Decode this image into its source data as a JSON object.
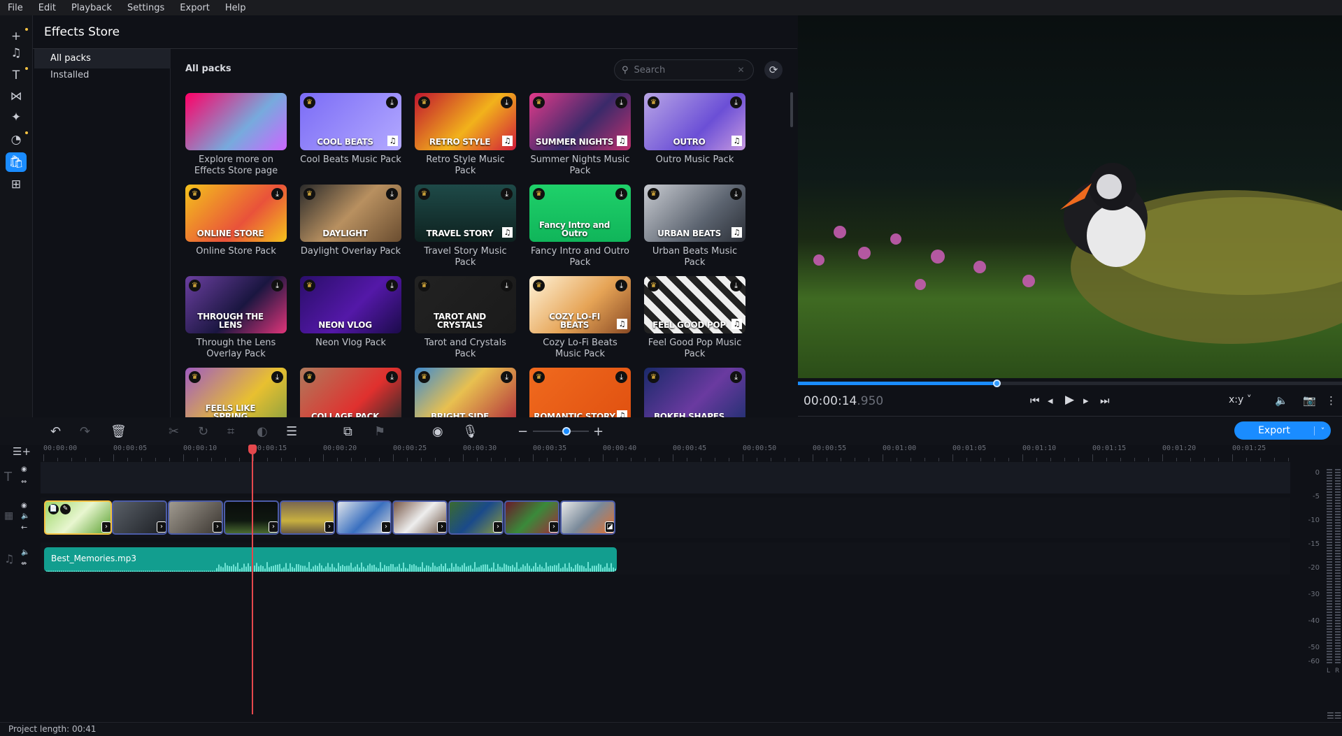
{
  "menu": [
    "File",
    "Edit",
    "Playback",
    "Settings",
    "Export",
    "Help"
  ],
  "sidebar_icons": [
    {
      "name": "add-icon",
      "glyph": "+",
      "dot": true
    },
    {
      "name": "music-icon",
      "glyph": "♫",
      "dot": false
    },
    {
      "name": "text-icon",
      "glyph": "T",
      "dot": true
    },
    {
      "name": "transitions-icon",
      "glyph": "⋈",
      "dot": false
    },
    {
      "name": "effects-icon",
      "glyph": "✦",
      "dot": false
    },
    {
      "name": "stickers-icon",
      "glyph": "◔",
      "dot": true
    },
    {
      "name": "store-icon",
      "glyph": "🛍",
      "dot": false,
      "active": true
    },
    {
      "name": "more-tools-icon",
      "glyph": "⊞",
      "dot": false
    }
  ],
  "store": {
    "title": "Effects Store",
    "nav": [
      {
        "label": "All packs",
        "active": true
      },
      {
        "label": "Installed",
        "active": false
      }
    ],
    "grid_title": "All packs",
    "search_placeholder": "Search",
    "packs": [
      {
        "label": "Explore more on Effects Store page",
        "overlay": "",
        "bg": "linear-gradient(135deg,#f06,#7ad 60%,#c6f)",
        "premium": false,
        "music": false
      },
      {
        "label": "Cool Beats Music Pack",
        "overlay": "COOL BEATS",
        "bg": "linear-gradient(135deg,#7b6cf6,#b3a9ff)",
        "premium": true,
        "music": true
      },
      {
        "label": "Retro Style Music Pack",
        "overlay": "RETRO STYLE",
        "bg": "linear-gradient(135deg,#c0152f,#f2b21b 55%,#d01b3a)",
        "premium": true,
        "music": true
      },
      {
        "label": "Summer Nights Music Pack",
        "overlay": "SUMMER NIGHTS",
        "bg": "linear-gradient(135deg,#e23a8a,#3a2a6a 55%,#c0306e)",
        "premium": true,
        "music": true
      },
      {
        "label": "Outro Music Pack",
        "overlay": "OUTRO",
        "bg": "linear-gradient(135deg,#b9a6e6,#6b4fd6 60%,#c79ae0)",
        "premium": true,
        "music": true
      },
      {
        "label": "Online Store Pack",
        "overlay": "ONLINE STORE",
        "bg": "linear-gradient(135deg,#f4c21c,#e9523a 60%,#f4c21c)",
        "premium": true,
        "music": false
      },
      {
        "label": "Daylight Overlay Pack",
        "overlay": "DAYLIGHT",
        "bg": "linear-gradient(135deg,#2a2a2a,#b89060 50%,#6a4d30)",
        "premium": true,
        "music": false
      },
      {
        "label": "Travel Story Music Pack",
        "overlay": "TRAVEL STORY",
        "bg": "linear-gradient(180deg,#1e4a48,#0e2220)",
        "premium": true,
        "music": true
      },
      {
        "label": "Fancy Intro and Outro Pack",
        "overlay": "Fancy Intro and Outro",
        "bg": "linear-gradient(180deg,#1fd16a,#10b55a)",
        "premium": true,
        "music": false
      },
      {
        "label": "Urban Beats Music Pack",
        "overlay": "URBAN BEATS",
        "bg": "linear-gradient(135deg,#c9ccd2,#5c6470 60%,#2a2e36)",
        "premium": true,
        "music": true
      },
      {
        "label": "Through the Lens Overlay Pack",
        "overlay": "THROUGH THE LENS",
        "bg": "linear-gradient(135deg,#6b3fa0,#1a1640 55%,#e0357a)",
        "premium": true,
        "music": false
      },
      {
        "label": "Neon Vlog Pack",
        "overlay": "NEON VLOG",
        "bg": "linear-gradient(135deg,#2a0e6a,#5418a8 55%,#1b0b4a)",
        "premium": true,
        "music": false
      },
      {
        "label": "Tarot and Crystals Pack",
        "overlay": "TAROT AND CRYSTALS",
        "bg": "linear-gradient(135deg,#222,#1a1a1a)",
        "premium": true,
        "music": false
      },
      {
        "label": "Cozy Lo-Fi Beats Music Pack",
        "overlay": "COZY LO-FI BEATS",
        "bg": "linear-gradient(135deg,#fff3d8,#e6a456 55%,#8a4a24)",
        "premium": true,
        "music": true
      },
      {
        "label": "Feel Good Pop Music Pack",
        "overlay": "FEEL GOOD POP",
        "bg": "repeating-linear-gradient(45deg,#222 0 10px,#eee 10px 20px)",
        "premium": true,
        "music": true
      },
      {
        "label": "",
        "overlay": "FEELS LIKE SPRING",
        "bg": "linear-gradient(135deg,#a05cc0,#e8c030 60%,#8aa040)",
        "premium": true,
        "music": false
      },
      {
        "label": "",
        "overlay": "COLLAGE PACK",
        "bg": "linear-gradient(135deg,#b07a5c,#e0302e 60%,#2a2a2a)",
        "premium": true,
        "music": false
      },
      {
        "label": "",
        "overlay": "BRIGHT SIDE",
        "bg": "linear-gradient(135deg,#3c8ad0,#e8c050 45%,#b02a3a)",
        "premium": true,
        "music": false
      },
      {
        "label": "",
        "overlay": "ROMANTIC STORY",
        "bg": "linear-gradient(135deg,#f06a1e,#e05010)",
        "premium": true,
        "music": true
      },
      {
        "label": "",
        "overlay": "BOKEH SHAPES",
        "bg": "linear-gradient(135deg,#1a2a6a,#6a3aa0 55%,#203070)",
        "premium": true,
        "music": false
      }
    ]
  },
  "player": {
    "timecode_main": "00:00:14",
    "timecode_ms": ".950",
    "progress_percent": 36.6,
    "aspect_label": "x:y"
  },
  "timeline": {
    "export_label": "Export",
    "ruler": [
      "00:00:00",
      "00:00:05",
      "00:00:10",
      "00:00:15",
      "00:00:20",
      "00:00:25",
      "00:00:30",
      "00:00:35",
      "00:00:40",
      "00:00:45",
      "00:00:50",
      "00:00:55",
      "00:01:00",
      "00:01:05",
      "00:01:10",
      "00:01:15",
      "00:01:20",
      "00:01:25"
    ],
    "playhead_seconds": 14.95,
    "clips": [
      {
        "bg": "linear-gradient(135deg,#9ed86a,#e8f6d0 50%,#5aa030)",
        "selected": true
      },
      {
        "bg": "linear-gradient(135deg,#5a6068,#1c1f24)"
      },
      {
        "bg": "linear-gradient(135deg,#a09a90,#3a3530)"
      },
      {
        "bg": "linear-gradient(180deg,#0a0c0c,#0f1810 60%,#4a6a30)"
      },
      {
        "bg": "linear-gradient(180deg,#7a6850,#c8b040 60%,#6a5a40)"
      },
      {
        "bg": "linear-gradient(135deg,#e0e4ea,#3a70c0 55%,#d0d4da)"
      },
      {
        "bg": "linear-gradient(135deg,#7a5a4a,#eeeeee 50%,#6a5040)"
      },
      {
        "bg": "linear-gradient(135deg,#3a6a30,#1a4a8a 50%,#8a9a40)"
      },
      {
        "bg": "linear-gradient(135deg,#6a1a2a,#3a8a3a 50%,#a02a3a)"
      },
      {
        "bg": "linear-gradient(135deg,#e8e8e8,#7a8a9a 50%,#e07030)"
      }
    ],
    "audio_clip": "Best_Memories.mp3",
    "meter_labels": [
      "0",
      "-5",
      "-10",
      "-15",
      "-20",
      "-30",
      "-40",
      "-50",
      "-60"
    ],
    "meter_channels": [
      "L",
      "R"
    ]
  },
  "status": {
    "project_length": "Project length: 00:41"
  },
  "colors": {
    "accent": "#1a8cff",
    "playhead": "#e5484d",
    "audio_clip": "#129e8f",
    "premium": "#f5c242"
  }
}
